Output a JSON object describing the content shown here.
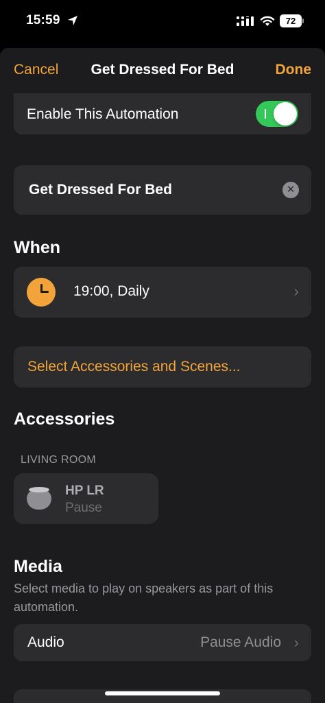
{
  "status_bar": {
    "time": "15:59",
    "battery": "72"
  },
  "nav": {
    "cancel": "Cancel",
    "title": "Get Dressed For Bed",
    "done": "Done"
  },
  "enable": {
    "label": "Enable This Automation",
    "enabled": true
  },
  "name_field": {
    "value": "Get Dressed For Bed"
  },
  "when": {
    "title": "When",
    "value": "19:00, Daily"
  },
  "select_button": {
    "label": "Select Accessories and Scenes..."
  },
  "accessories": {
    "title": "Accessories",
    "room": "LIVING ROOM",
    "items": [
      {
        "name": "HP LR",
        "status": "Pause",
        "icon": "homepod-mini-icon"
      }
    ]
  },
  "media": {
    "title": "Media",
    "description": "Select media to play on speakers as part of this automation.",
    "audio_label": "Audio",
    "audio_value": "Pause Audio"
  },
  "colors": {
    "accent": "#f2a33a",
    "toggle_on": "#34c759",
    "background": "#1c1c1e",
    "card": "#2c2c2e"
  }
}
